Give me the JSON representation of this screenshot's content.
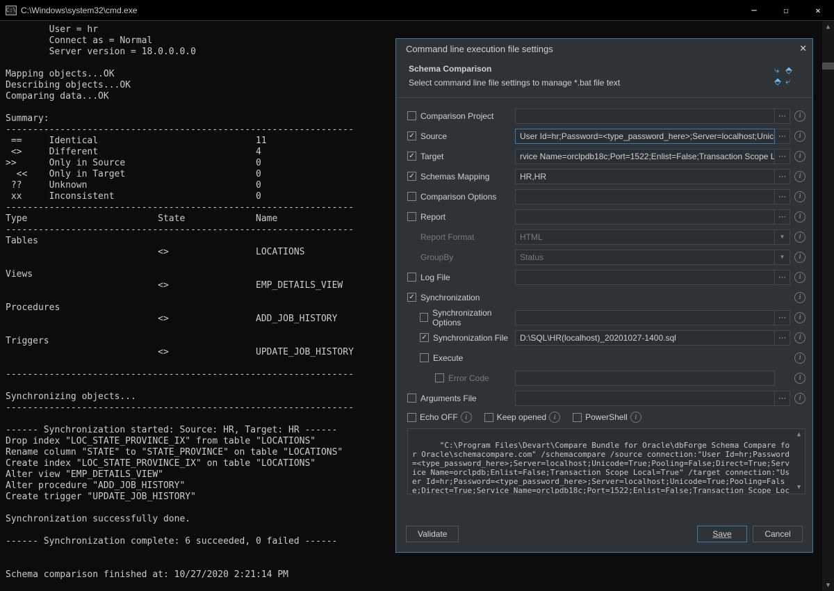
{
  "window": {
    "title": "C:\\Windows\\system32\\cmd.exe",
    "icon_label": "C:\\"
  },
  "terminal": {
    "content": "        User = hr\n        Connect as = Normal\n        Server version = 18.0.0.0.0\n\nMapping objects...OK\nDescribing objects...OK\nComparing data...OK\n\nSummary:\n----------------------------------------------------------------\n ==     Identical                             11\n <>     Different                             4\n>>      Only in Source                        0\n  <<    Only in Target                        0\n ??     Unknown                               0\n xx     Inconsistent                          0\n----------------------------------------------------------------\nType                        State             Name\n----------------------------------------------------------------\nTables\n                            <>                LOCATIONS\n\nViews\n                            <>                EMP_DETAILS_VIEW\n\nProcedures\n                            <>                ADD_JOB_HISTORY\n\nTriggers\n                            <>                UPDATE_JOB_HISTORY\n\n----------------------------------------------------------------\n\nSynchronizing objects...\n----------------------------------------------------------------\n\n------ Synchronization started: Source: HR, Target: HR ------\nDrop index \"LOC_STATE_PROVINCE_IX\" from table \"LOCATIONS\"\nRename column \"STATE\" to \"STATE_PROVINCE\" on table \"LOCATIONS\"\nCreate index \"LOC_STATE_PROVINCE_IX\" on table \"LOCATIONS\"\nAlter view \"EMP_DETAILS_VIEW\"\nAlter procedure \"ADD_JOB_HISTORY\"\nCreate trigger \"UPDATE_JOB_HISTORY\"\n\nSynchronization successfully done.\n\n------ Synchronization complete: 6 succeeded, 0 failed ------\n\n\nSchema comparison finished at: 10/27/2020 2:21:14 PM"
  },
  "dialog": {
    "title": "Command line execution file settings",
    "section_title": "Schema Comparison",
    "section_sub": "Select command line file settings to manage *.bat file text",
    "rows": {
      "comparison_project": {
        "label": "Comparison Project",
        "checked": false,
        "value": "",
        "ellipsis": true,
        "info": true
      },
      "source": {
        "label": "Source",
        "checked": true,
        "value": "User Id=hr;Password=<type_password_here>;Server=localhost;Unicode=True",
        "ellipsis": true,
        "info": true
      },
      "target": {
        "label": "Target",
        "checked": true,
        "value": "rvice Name=orclpdb18c;Port=1522;Enlist=False;Transaction Scope Local=True",
        "ellipsis": true,
        "info": true
      },
      "schemas_mapping": {
        "label": "Schemas Mapping",
        "checked": true,
        "value": "HR,HR",
        "ellipsis": true,
        "info": true
      },
      "comparison_options": {
        "label": "Comparison Options",
        "checked": false,
        "value": "",
        "ellipsis": true,
        "info": true
      },
      "report": {
        "label": "Report",
        "checked": false,
        "value": "",
        "ellipsis": true,
        "info": true
      },
      "report_format": {
        "label": "Report Format",
        "value": "HTML",
        "info": true
      },
      "group_by": {
        "label": "GroupBy",
        "value": "Status",
        "info": true
      },
      "log_file": {
        "label": "Log File",
        "checked": false,
        "value": "",
        "ellipsis": true,
        "info": true
      },
      "synchronization": {
        "label": "Synchronization",
        "checked": true,
        "info": true
      },
      "sync_options": {
        "label": "Synchronization Options",
        "checked": false,
        "value": "",
        "ellipsis": true,
        "info": true
      },
      "sync_file": {
        "label": "Synchronization File",
        "checked": true,
        "value": "D:\\SQL\\HR(localhost)_20201027-1400.sql",
        "ellipsis": true,
        "info": true
      },
      "execute": {
        "label": "Execute",
        "checked": false,
        "info": true
      },
      "error_code": {
        "label": "Error Code",
        "checked": false,
        "value": "",
        "info": true
      },
      "arguments_file": {
        "label": "Arguments File",
        "checked": false,
        "value": "",
        "ellipsis": true,
        "info": true
      }
    },
    "options": {
      "echo_off": "Echo OFF",
      "keep_opened": "Keep opened",
      "powershell": "PowerShell"
    },
    "cmdtext": "\"C:\\Program Files\\Devart\\Compare Bundle for Oracle\\dbForge Schema Compare for Oracle\\schemacompare.com\" /schemacompare /source connection:\"User Id=hr;Password=<type_password_here>;Server=localhost;Unicode=True;Pooling=False;Direct=True;Service Name=orclpdb;Enlist=False;Transaction Scope Local=True\" /target connection:\"User Id=hr;Password=<type_password_here>;Server=localhost;Unicode=True;Pooling=False;Direct=True;Service Name=orclpdb18c;Port=1522;Enlist=False;Transaction Scope Local=True\" /schemas:HR,HR /sync:\"D:\\SQL\\HR(localhost)_20201027-1400.sql\"",
    "buttons": {
      "validate": "Validate",
      "save": "Save",
      "cancel": "Cancel"
    }
  }
}
